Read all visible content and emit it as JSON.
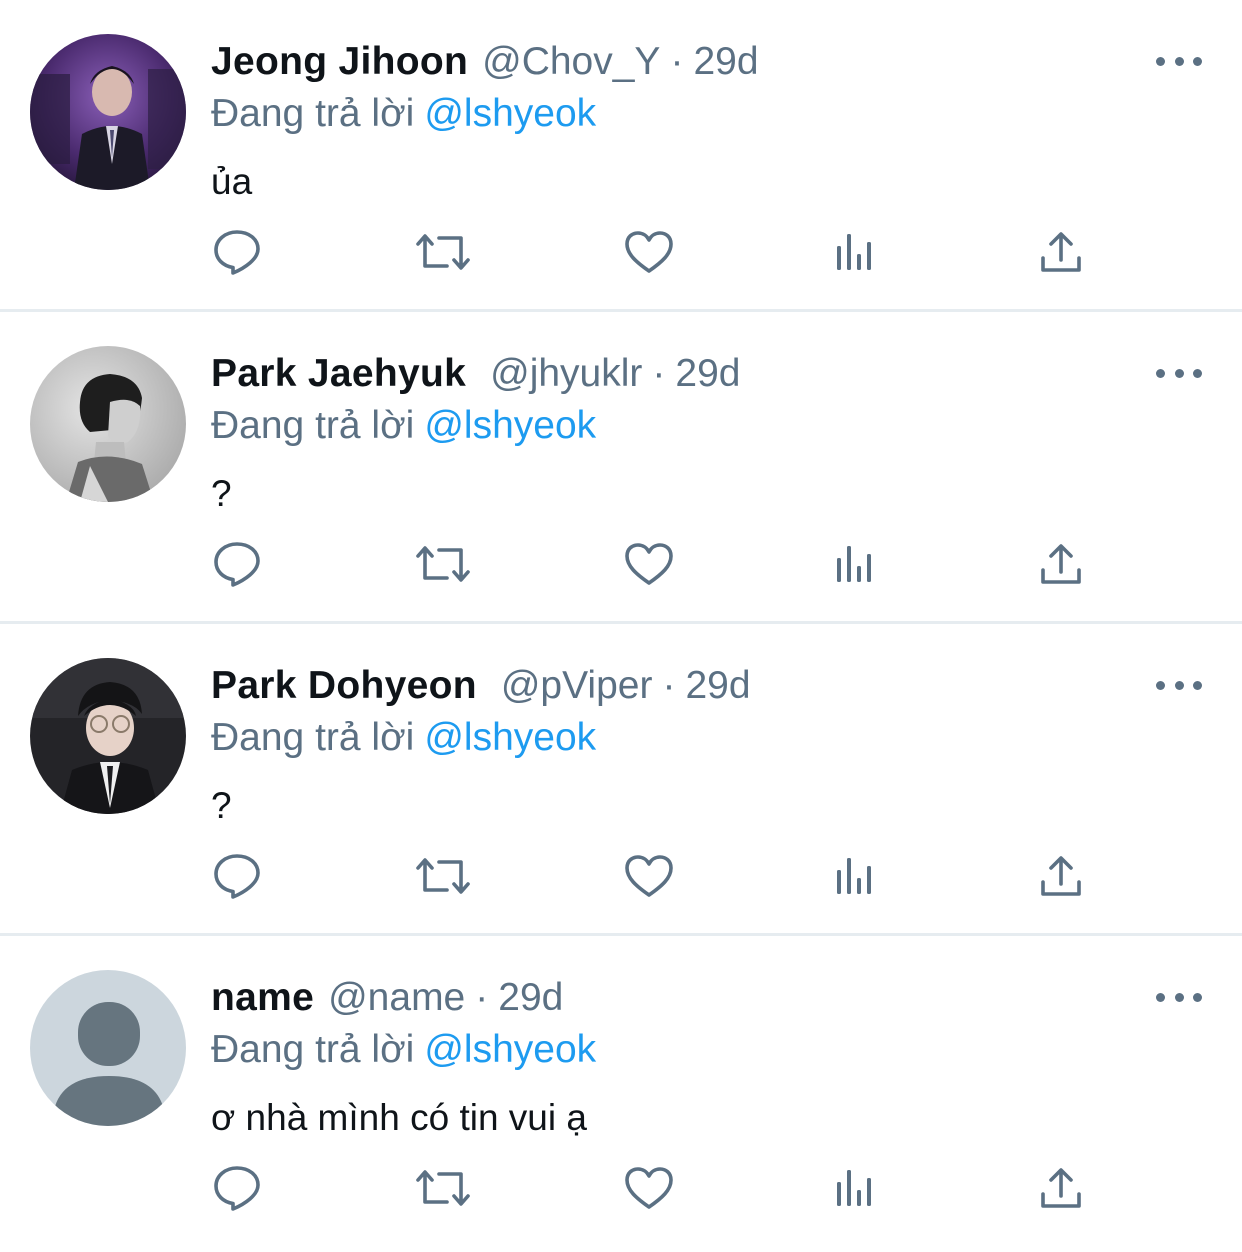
{
  "feed": {
    "accent_color": "#1d9bf0",
    "secondary_color": "#5b7083",
    "action_icons": [
      "reply-icon",
      "retweet-icon",
      "like-icon",
      "analytics-icon",
      "share-icon"
    ],
    "more_icon": "more-dots-icon",
    "separator": "·",
    "tweets": [
      {
        "display_name": "Jeong Jihoon",
        "handle": "@Chov_Y",
        "time": "29d",
        "reply_prefix": "Đang trả lời",
        "reply_to": "@lshyeok",
        "text": "ủa"
      },
      {
        "display_name": "Park Jaehyuk",
        "handle": "@jhyuklr",
        "time": "29d",
        "reply_prefix": "Đang trả lời",
        "reply_to": "@lshyeok",
        "text": "?"
      },
      {
        "display_name": "Park Dohyeon",
        "handle": "@pViper",
        "time": "29d",
        "reply_prefix": "Đang trả lời",
        "reply_to": "@lshyeok",
        "text": "?"
      },
      {
        "display_name": "name",
        "handle": "@name",
        "time": "29d",
        "reply_prefix": "Đang trả lời",
        "reply_to": "@lshyeok",
        "text": "ơ nhà mình có tin vui ạ"
      }
    ]
  }
}
